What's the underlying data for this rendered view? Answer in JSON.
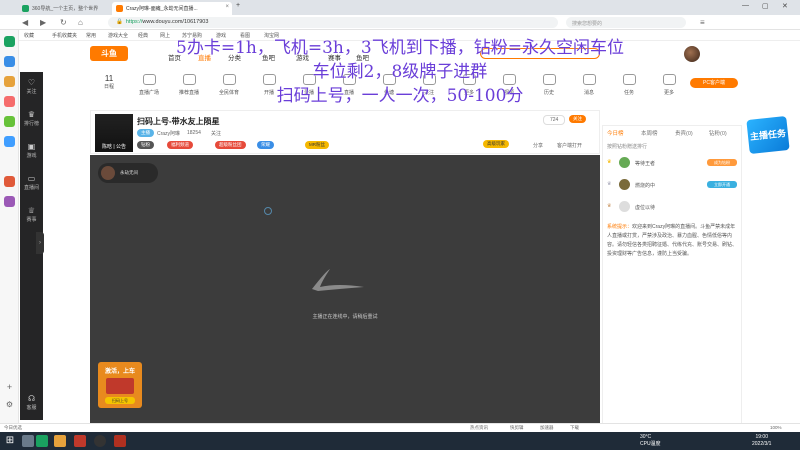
{
  "browser": {
    "tabs": [
      {
        "title": "360导航_一个主页，整个世界",
        "color": "#1aa260"
      },
      {
        "title": "Crazy阿琳-面瘫_永劫无间直播...",
        "color": "#ff7a00"
      }
    ],
    "new_tab": "+",
    "url_scheme": "https://",
    "url": "www.douyu.com/10617903",
    "search_placeholder": "搜索您想要的",
    "bookmarks": [
      "收藏",
      "手机收藏夹",
      "常用",
      "游戏大全",
      "经典",
      "网上",
      "苏宁易购",
      "游戏",
      "看图",
      "淘宝网"
    ]
  },
  "site": {
    "logo": "斗鱼",
    "nav": [
      "首页",
      "直播",
      "分类",
      "鱼吧",
      "游戏",
      "赛事",
      "鱼吧"
    ],
    "active_nav": "直播",
    "categories": [
      {
        "label": "日程",
        "count": "11"
      },
      {
        "label": "直播广场"
      },
      {
        "label": "推荐直播"
      },
      {
        "label": "全民体育"
      },
      {
        "label": "开播"
      },
      {
        "label": "录播"
      },
      {
        "label": "直播"
      },
      {
        "label": "鱼塘"
      },
      {
        "label": "关注"
      },
      {
        "label": "更多"
      },
      {
        "label": "视频"
      },
      {
        "label": "历史"
      },
      {
        "label": "消息"
      },
      {
        "label": "任务"
      },
      {
        "label": "更多"
      }
    ],
    "pc_button": "PC客户端"
  },
  "overlay_text": {
    "line1": "5办卡=1h，飞机=3h，3飞机到下播，钻粉=永久空闲车位",
    "line2": "车位剩2，8级牌子进群",
    "line3": "扫码上号，一人一次，50-100分"
  },
  "sidebar": [
    {
      "label": "关注",
      "icon": "heart-icon"
    },
    {
      "label": "排行榜",
      "icon": "trophy-icon"
    },
    {
      "label": "游戏",
      "icon": "gamepad-icon"
    },
    {
      "label": "直播间",
      "icon": "tv-icon"
    },
    {
      "label": "赛事",
      "icon": "cup-icon"
    },
    {
      "label": "客服",
      "icon": "headset-icon"
    }
  ],
  "room": {
    "title": "扫码上号-带水友上陨星",
    "streamer_tag": "陈晗 | 公告",
    "streamer": "Crazy阿琳",
    "follow_count": "18254",
    "follow_label": "关注",
    "follow_btn": "关注",
    "viewer_count": "724",
    "share": "分享",
    "client": "客户端打开",
    "badges": [
      "主播",
      "钻粉",
      "福利频道",
      "超级粉丝团",
      "荣耀",
      "MR粉丝"
    ],
    "recommend": "高级玩家"
  },
  "video": {
    "status": "主播正在连线中，请稍后重试",
    "ad_title": "激活，上车",
    "ad_sub": "扫码上号",
    "top_box": "永劫无间"
  },
  "chat": {
    "tabs": [
      "今日榜",
      "本周榜",
      "贵宾(0)",
      "钻粉(0)"
    ],
    "list_title": "按照钻粉赠送排行",
    "rows": [
      {
        "name": "等待王者",
        "btn": "成为钻粉"
      },
      {
        "name": "燃烧的中",
        "btn": "立即开通"
      },
      {
        "name": "虚位以待",
        "btn": ""
      }
    ],
    "system_label": "系统提示：",
    "system_text": "欢迎来到Crazy阿琳的直播间。斗鱼严禁未成年人直播或打赏，严禁涉及政治、暴力血腥、色情低俗等内容。请勿轻信各类招聘征婚、代练代充、账号交易、刷钻、投资理财等广告信息，谨防上当受骗。"
  },
  "statusbar": [
    "今日优选",
    "热点资讯",
    "快剪辑",
    "加速器",
    "下载",
    "100%"
  ],
  "tray": {
    "temp": "30°C",
    "label": "CPU温度",
    "time": "19:00",
    "date": "2022/3/1"
  }
}
